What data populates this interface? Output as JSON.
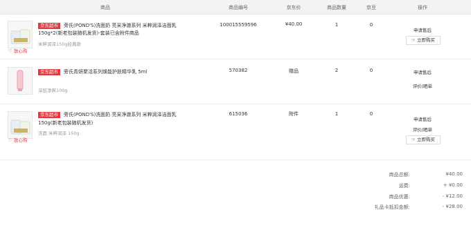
{
  "header": {
    "product": "商品",
    "sku": "商品编号",
    "price": "京东价",
    "qty": "商品数量",
    "bean": "京豆",
    "ops": "操作"
  },
  "rows": [
    {
      "badge": "京东超市",
      "name_line1": "旁氏(POND'S)洗面奶 亮采净澈系列 米粹润泽洁面乳",
      "name_line2": "150g*2(新老包装随机发货)-套装已含附件商品",
      "spec": "米粹润泽150g经典款",
      "sku": "100015559596",
      "price": "¥40.00",
      "qty": "1",
      "bean": "0",
      "after_sale": "申请售后",
      "buy_again": "立即购买",
      "trust": "放心购"
    },
    {
      "badge": "京东超市",
      "name_line1": "旁氏青妍聚活系列焕能护肤精华乳 5ml",
      "spec": "深层净爽100g",
      "sku": "570382",
      "price": "赠品",
      "qty": "2",
      "bean": "0",
      "after_sale": "申请售后",
      "review": "评价|晒单"
    },
    {
      "badge": "京东超市",
      "name_line1": "旁氏(POND'S)洗面奶 亮采净澈系列 米粹润泽洁面乳",
      "name_line2": "150g(新老包装随机发货)",
      "spec": "洗面 米粹润泽 150g",
      "sku": "615036",
      "price": "附件",
      "qty": "1",
      "bean": "0",
      "after_sale": "申请售后",
      "review": "评价|晒单",
      "buy_again": "立即购买",
      "trust": "放心购"
    }
  ],
  "summary": [
    {
      "label": "商品总额:",
      "value": "¥40.00"
    },
    {
      "label": "运费:",
      "value": "+ ¥0.00"
    },
    {
      "label": "商品优惠:",
      "value": "- ¥12.00"
    },
    {
      "label": "礼品卡抵扣金额:",
      "value": "- ¥28.00"
    }
  ],
  "colors": {
    "accent": "#e4393c",
    "header_bg": "#f3f3f3"
  }
}
